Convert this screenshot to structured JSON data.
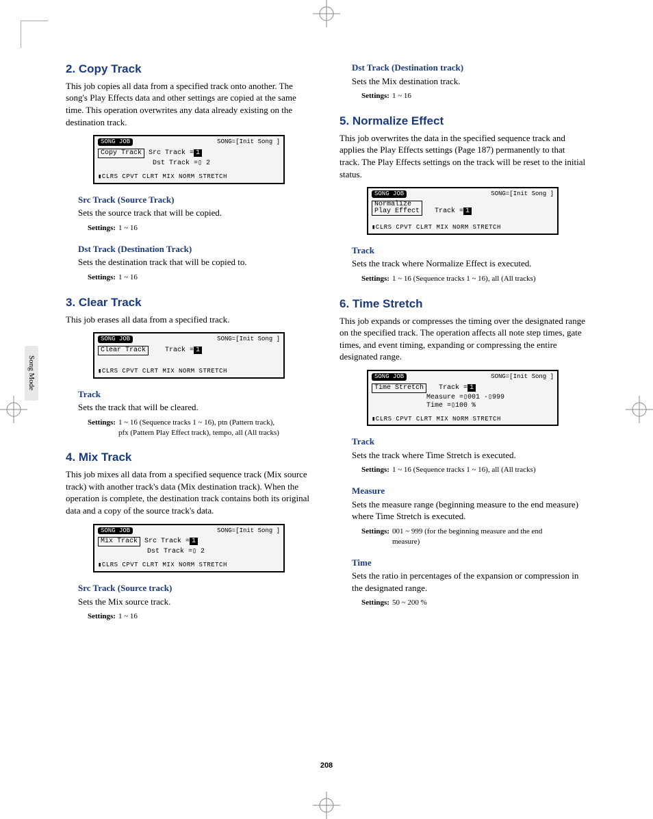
{
  "sideTab": "Song Mode",
  "pageNumber": "208",
  "left": {
    "sec2": {
      "title": "2. Copy Track",
      "body": "This job copies all data from a specified track onto another. The song's Play Effects data and other settings are copied at the same time. This operation overwrites any data already existing on the destination track.",
      "screen": {
        "badge": "SONG JOB",
        "status": "SONG=[Init Song ]",
        "line1a": "Copy Track",
        "line1b": "Src Track =",
        "line1c": "1",
        "line2": "Dst Track =▯ 2",
        "tabs": "▮CLRS CPVT CLRT MIX  NORM STRETCH"
      },
      "p1": {
        "title": "Src Track (Source Track)",
        "desc": "Sets the source track that will be copied.",
        "settingsLabel": "Settings:",
        "settingsVal": "1 ~ 16"
      },
      "p2": {
        "title": "Dst Track (Destination Track)",
        "desc": "Sets the destination track that will be copied to.",
        "settingsLabel": "Settings:",
        "settingsVal": "1 ~ 16"
      }
    },
    "sec3": {
      "title": "3. Clear Track",
      "body": "This job erases all data from a specified track.",
      "screen": {
        "badge": "SONG JOB",
        "status": "SONG=[Init Song ]",
        "line1a": "Clear Track",
        "line1b": "Track =",
        "line1c": "1   ",
        "tabs": "▮CLRS CPVT CLRT MIX  NORM STRETCH"
      },
      "p1": {
        "title": "Track",
        "desc": "Sets the track that will be cleared.",
        "settingsLabel": "Settings:",
        "settingsVal": "1 ~ 16 (Sequence tracks 1 ~ 16), ptn (Pattern track), pfx (Pattern Play Effect track), tempo, all (All tracks)"
      }
    },
    "sec4": {
      "title": "4. Mix Track",
      "body": "This job mixes all data from a specified sequence track (Mix source track) with another track's data (Mix destination track). When the operation is complete, the destination track contains both its original data and a copy of the source track's data.",
      "screen": {
        "badge": "SONG JOB",
        "status": "SONG=[Init Song ]",
        "line1a": "Mix Track",
        "line1b": "Src Track =",
        "line1c": "1",
        "line2": "Dst Track =▯ 2",
        "tabs": "▮CLRS CPVT CLRT MIX  NORM STRETCH"
      },
      "p1": {
        "title": "Src Track (Source track)",
        "desc": "Sets the Mix source track.",
        "settingsLabel": "Settings:",
        "settingsVal": "1 ~ 16"
      }
    }
  },
  "right": {
    "sec4b": {
      "p2": {
        "title": "Dst Track (Destination track)",
        "desc": "Sets the Mix destination track.",
        "settingsLabel": "Settings:",
        "settingsVal": "1 ~ 16"
      }
    },
    "sec5": {
      "title": "5. Normalize Effect",
      "body": "This job overwrites the data in the specified sequence track and applies the Play Effects settings (Page 187) permanently to that track. The Play Effects settings on the track will be reset to the initial status.",
      "screen": {
        "badge": "SONG JOB",
        "status": "SONG=[Init Song ]",
        "line1a": "Normalize",
        "line1a2": "  Play Effect",
        "line1b": "Track =",
        "line1c": "1",
        "tabs": "▮CLRS CPVT CLRT MIX  NORM STRETCH"
      },
      "p1": {
        "title": "Track",
        "desc": "Sets the track where Normalize Effect is executed.",
        "settingsLabel": "Settings:",
        "settingsVal": "1 ~ 16 (Sequence tracks 1 ~ 16), all (All tracks)"
      }
    },
    "sec6": {
      "title": "6. Time Stretch",
      "body": "This job expands or compresses the timing over the designated range on the specified track. The operation affects all note step times, gate times, and event timing, expanding or compressing the entire designated range.",
      "screen": {
        "badge": "SONG JOB",
        "status": "SONG=[Init Song ]",
        "line1a": "Time Stretch",
        "line1b": "Track =",
        "line1c": "1",
        "line2": "Measure =▯001 -▯999",
        "line3": "   Time =▯100 %",
        "tabs": "▮CLRS CPVT CLRT MIX  NORM STRETCH"
      },
      "p1": {
        "title": "Track",
        "desc": "Sets the track where Time Stretch is executed.",
        "settingsLabel": "Settings:",
        "settingsVal": "1 ~ 16 (Sequence tracks 1 ~ 16), all (All tracks)"
      },
      "p2": {
        "title": "Measure",
        "desc": "Sets the measure range (beginning measure to the end measure) where Time Stretch is executed.",
        "settingsLabel": "Settings:",
        "settingsVal": "001 ~ 999 (for the beginning measure and the end measure)"
      },
      "p3": {
        "title": "Time",
        "desc": "Sets the ratio in percentages of the expansion or compression in the designated range.",
        "settingsLabel": "Settings:",
        "settingsVal": "50 ~ 200 %"
      }
    }
  }
}
